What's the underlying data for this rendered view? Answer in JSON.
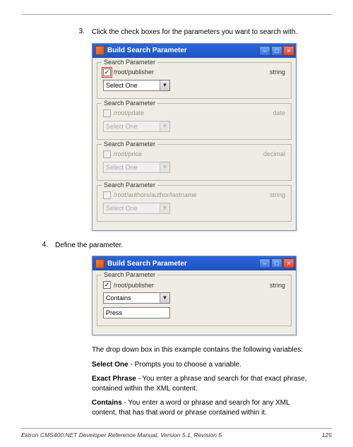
{
  "steps": {
    "s3_num": "3.",
    "s3_text": "Click the check boxes for the parameters you want to search with.",
    "s4_num": "4.",
    "s4_text": "Define the parameter."
  },
  "win1": {
    "title": "Build Search Parameter",
    "legend": "Search Parameter",
    "groups": [
      {
        "path": "/root/publisher",
        "type": "string",
        "checked": true,
        "highlight": true,
        "dd": "Select One",
        "disabled": false
      },
      {
        "path": "/root/pdate",
        "type": "date",
        "checked": false,
        "highlight": false,
        "dd": "Select One",
        "disabled": true
      },
      {
        "path": "/root/price",
        "type": "decimal",
        "checked": false,
        "highlight": false,
        "dd": "Select One",
        "disabled": true
      },
      {
        "path": "/root/authors/author/lastname",
        "type": "string",
        "checked": false,
        "highlight": false,
        "dd": "Select One",
        "disabled": true
      }
    ]
  },
  "win2": {
    "title": "Build Search Parameter",
    "legend": "Search Parameter",
    "path": "/root/publisher",
    "type": "string",
    "dd": "Contains",
    "input": "Press"
  },
  "explain": {
    "intro": "The drop down box in this example contains the following variables:",
    "v1_label": "Select One",
    "v1_text": " - Prompts you to choose a variable.",
    "v2_label": "Exact Phrase",
    "v2_text": " - You enter a phrase and search for that exact phrase, contained within the XML content.",
    "v3_label": "Contains",
    "v3_text": " - You enter a word or phrase and search for any XML content, that has that word or phrase contained within it."
  },
  "footer": {
    "left": "Ektron CMS400.NET Developer Reference Manual, Version 5.1, Revision 5",
    "page": "125"
  },
  "glyphs": {
    "min": "–",
    "max": "□",
    "close": "×",
    "arrow": "▼"
  }
}
